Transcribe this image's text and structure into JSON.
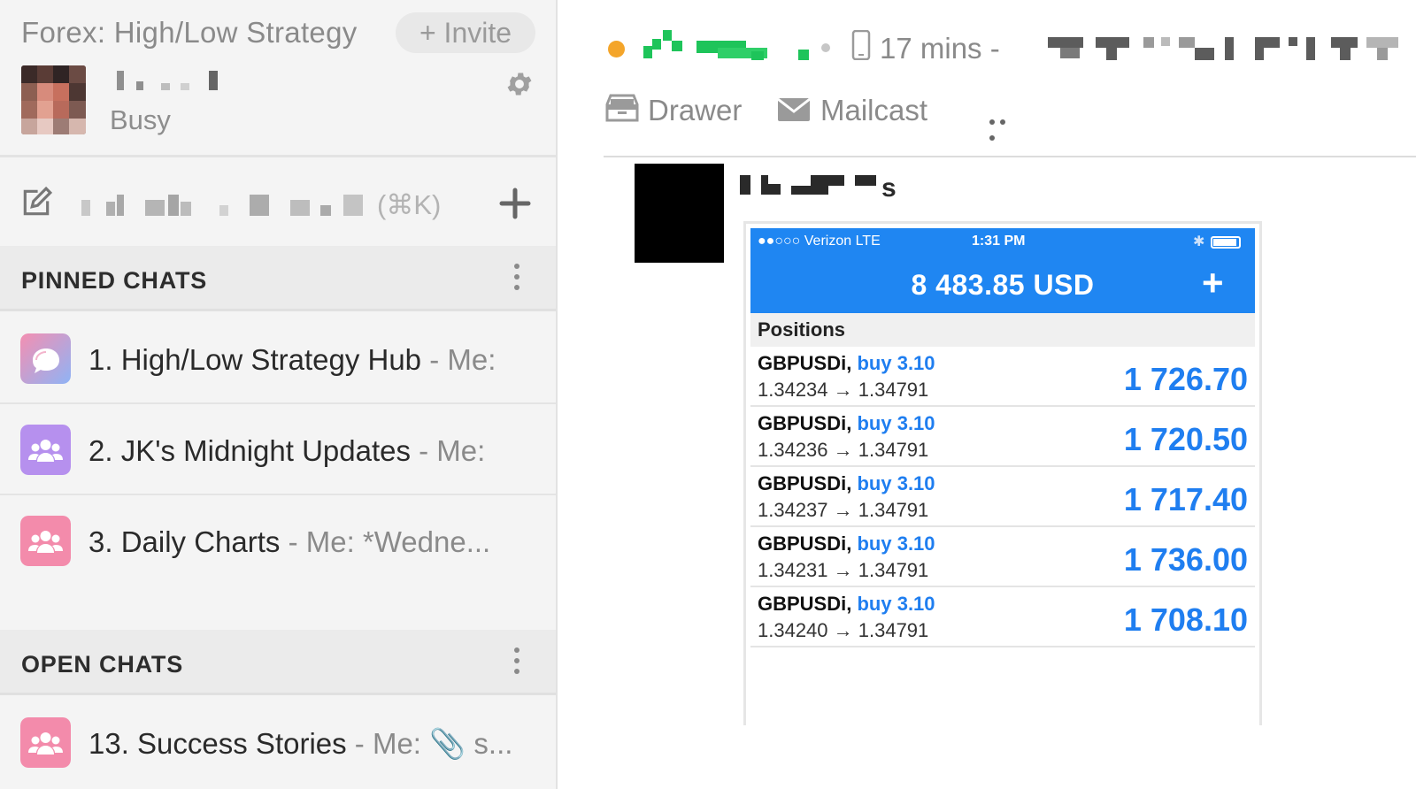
{
  "sidebar": {
    "workspace_title": "Forex: High/Low Strategy",
    "invite_label": "+ Invite",
    "user_status": "Busy",
    "search_shortcut": "(⌘K)",
    "pinned_header": "PINNED CHATS",
    "open_header": "OPEN CHATS",
    "pinned_chats": [
      {
        "name": "1. High/Low Strategy Hub",
        "preview": " - Me:",
        "icon": "chat-bubbles-icon"
      },
      {
        "name": "2. JK's Midnight Updates",
        "preview": " - Me:",
        "icon": "group-icon"
      },
      {
        "name": "3. Daily Charts",
        "preview": " - Me: *Wedne...",
        "icon": "group-icon"
      }
    ],
    "open_chats": [
      {
        "name": "13. Success Stories",
        "preview": " - Me: 📎 s...",
        "icon": "group-icon"
      }
    ]
  },
  "main": {
    "last_seen": "17 mins -",
    "tools": {
      "drawer": "Drawer",
      "mailcast": "Mailcast"
    },
    "sender_suffix": "s"
  },
  "screenshot": {
    "carrier": "●●○○○ Verizon   LTE",
    "time": "1:31 PM",
    "balance": "8 483.85 USD",
    "add": "+",
    "positions_label": "Positions",
    "positions": [
      {
        "symbol": "GBPUSDi,",
        "side": "buy 3.10",
        "prices": "1.34234 → 1.34791",
        "profit": "1 726.70"
      },
      {
        "symbol": "GBPUSDi,",
        "side": "buy 3.10",
        "prices": "1.34236 → 1.34791",
        "profit": "1 720.50"
      },
      {
        "symbol": "GBPUSDi,",
        "side": "buy 3.10",
        "prices": "1.34237 → 1.34791",
        "profit": "1 717.40"
      },
      {
        "symbol": "GBPUSDi,",
        "side": "buy 3.10",
        "prices": "1.34231 → 1.34791",
        "profit": "1 736.00"
      },
      {
        "symbol": "GBPUSDi,",
        "side": "buy 3.10",
        "prices": "1.34240 → 1.34791",
        "profit": "1 708.10"
      }
    ]
  },
  "colors": {
    "accent_blue": "#1f86f2",
    "profit_blue": "#1f7ef0",
    "presence_orange": "#f4a52a",
    "online_green": "#1ec45a",
    "chat_pink": "#f38bab",
    "chat_purple": "#b690ee"
  }
}
